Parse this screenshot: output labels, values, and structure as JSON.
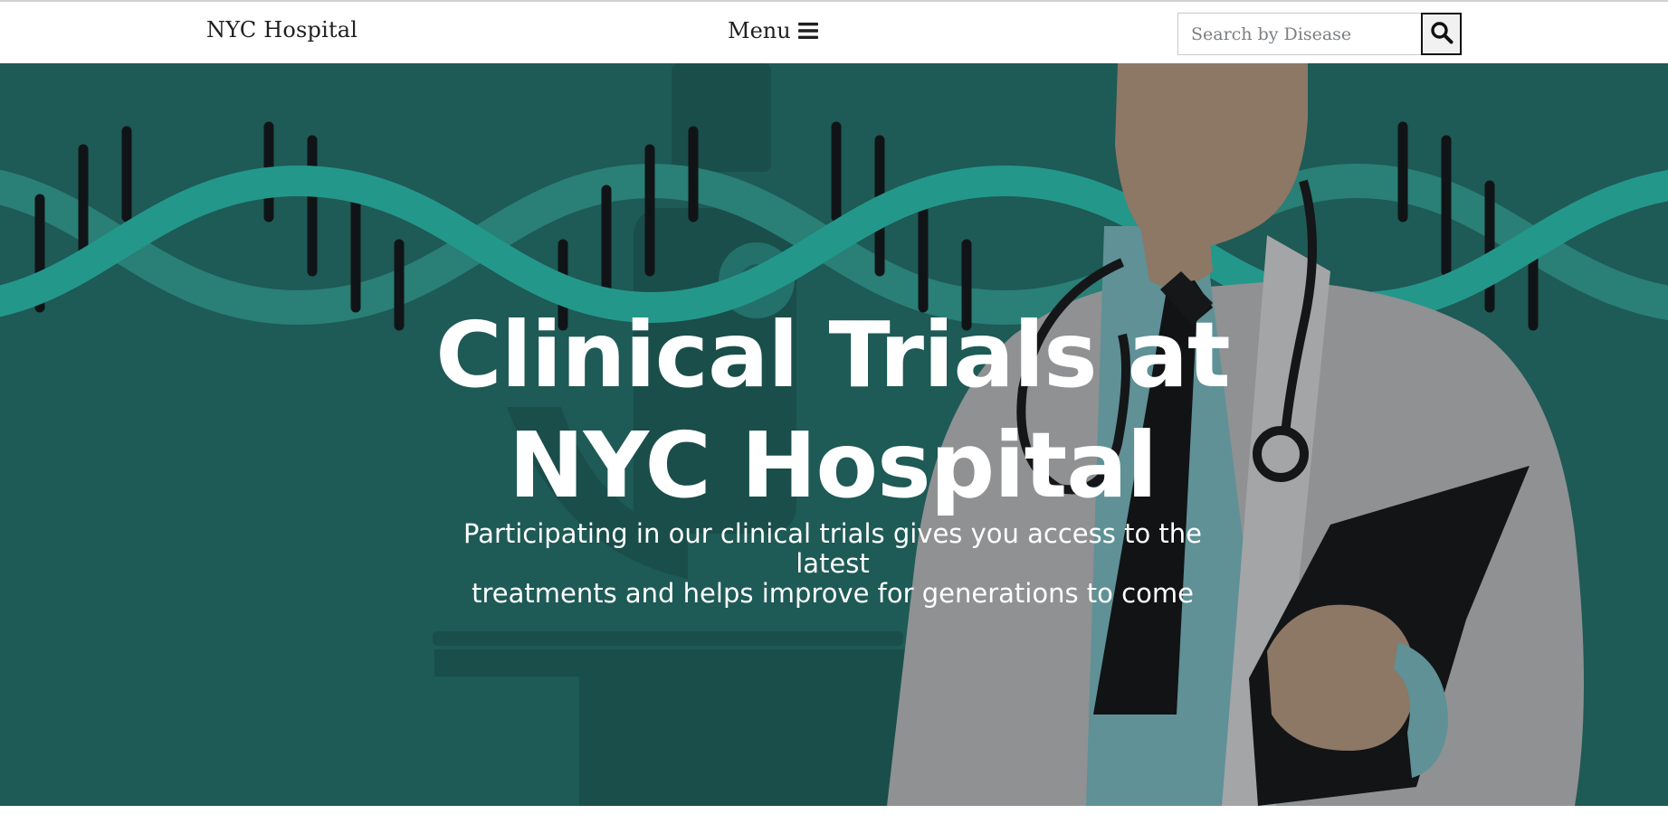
{
  "navbar": {
    "brand": "NYC Hospital",
    "menu_label": "Menu",
    "menu_icon": "hamburger-icon",
    "search": {
      "placeholder": "Search by Disease",
      "value": "",
      "button_icon": "search-icon"
    }
  },
  "hero": {
    "title_line1": "Clinical Trials at",
    "title_line2": "NYC Hospital",
    "subtitle_line1": "Participating in our clinical trials gives you access to the latest",
    "subtitle_line2": "treatments and helps improve for generations to come",
    "illustration": "doctor-with-dna-helix",
    "colors": {
      "background": "#1e5a56",
      "helix": "#24978b",
      "text": "#ffffff"
    }
  }
}
